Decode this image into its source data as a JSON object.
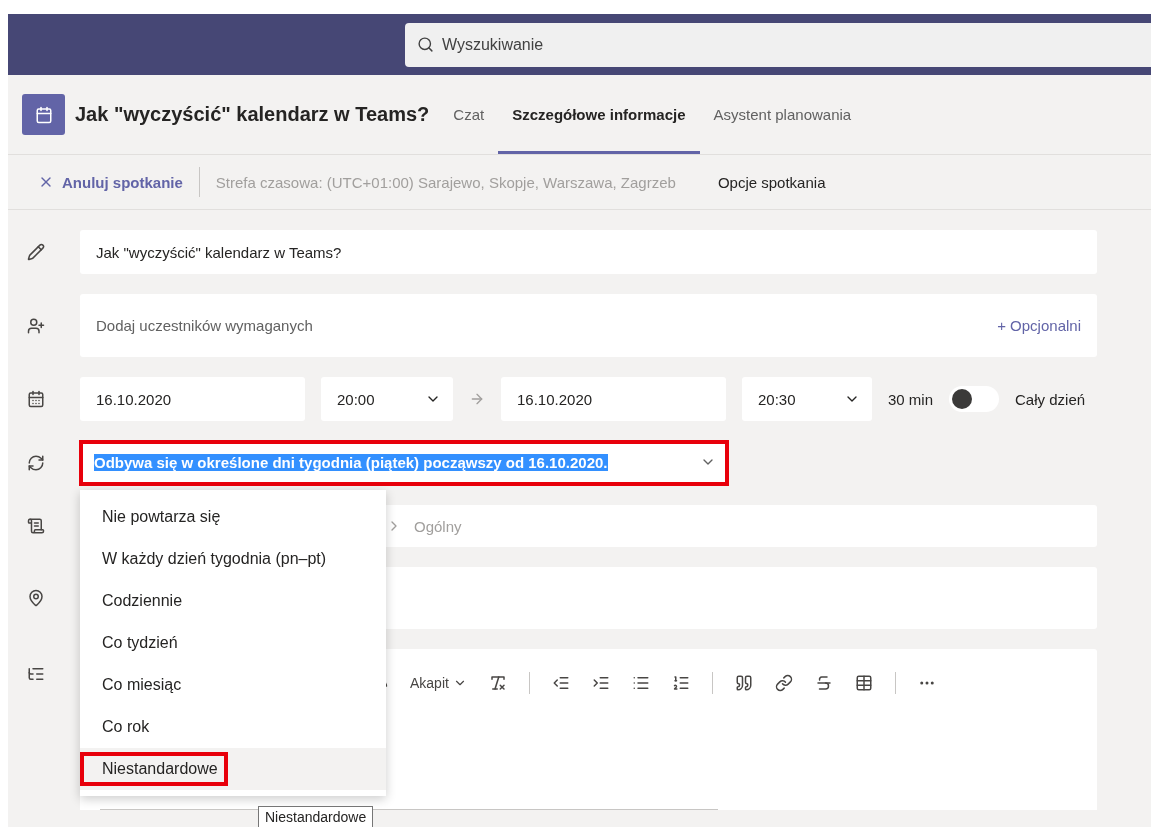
{
  "search": {
    "placeholder": "Wyszukiwanie"
  },
  "meeting": {
    "title": "Jak \"wyczyścić\" kalendarz w Teams?"
  },
  "tabs": [
    {
      "label": "Czat",
      "selected": false
    },
    {
      "label": "Szczegółowe informacje",
      "selected": true
    },
    {
      "label": "Asystent planowania",
      "selected": false
    }
  ],
  "actions": {
    "cancel": "Anuluj spotkanie",
    "timezone": "Strefa czasowa: (UTC+01:00) Sarajewo, Skopje, Warszawa, Zagrzeb",
    "options": "Opcje spotkania"
  },
  "form": {
    "subject": "Jak \"wyczyścić\" kalendarz w Teams?",
    "attendees": {
      "placeholder": "Dodaj uczestników wymaganych",
      "optional": "+ Opcjonalni"
    },
    "start_date": "16.10.2020",
    "start_time": "20:00",
    "end_date": "16.10.2020",
    "end_time": "20:30",
    "duration": "30 min",
    "all_day": {
      "label": "Cały dzień",
      "on": false
    },
    "recurrence": {
      "value": "Odbywa się w określone dni tygodnia (piątek) począwszy od 16.10.2020.",
      "annotated": true
    },
    "channel": {
      "placeholder": "Ogólny"
    },
    "editor": {
      "paragraph": "Akapit"
    }
  },
  "recurrence_menu": [
    {
      "label": "Nie powtarza się",
      "selected": false,
      "annotated": false
    },
    {
      "label": "W każdy dzień tygodnia (pn–pt)",
      "selected": false,
      "annotated": false
    },
    {
      "label": "Codziennie",
      "selected": false,
      "annotated": false
    },
    {
      "label": "Co tydzień",
      "selected": false,
      "annotated": false
    },
    {
      "label": "Co miesiąc",
      "selected": false,
      "annotated": false
    },
    {
      "label": "Co rok",
      "selected": false,
      "annotated": false
    },
    {
      "label": "Niestandardowe",
      "selected": true,
      "annotated": true
    }
  ],
  "tooltip": "Niestandardowe"
}
